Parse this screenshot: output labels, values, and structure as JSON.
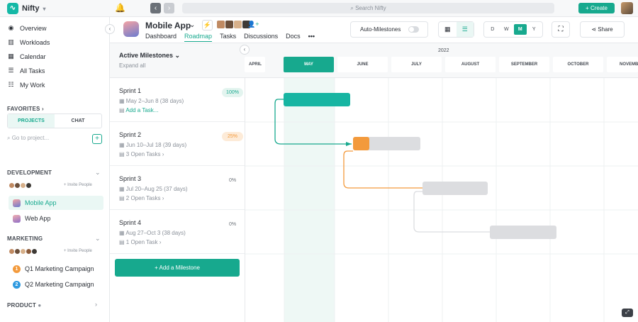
{
  "topbar": {
    "app_name": "Nifty",
    "search_placeholder": "Search Nifty",
    "create_label": "Create"
  },
  "sidebar": {
    "nav": [
      {
        "label": "Overview",
        "icon": "compass-icon"
      },
      {
        "label": "Workloads",
        "icon": "bar-chart-icon"
      },
      {
        "label": "Calendar",
        "icon": "calendar-icon"
      },
      {
        "label": "All Tasks",
        "icon": "list-icon"
      },
      {
        "label": "My Work",
        "icon": "checklist-icon"
      }
    ],
    "favorites_label": "FAVORITES",
    "tab_projects": "PROJECTS",
    "tab_chat": "CHAT",
    "goto_placeholder": "Go to project...",
    "development": {
      "label": "DEVELOPMENT",
      "invite": "+ Invite People",
      "projects": [
        "Mobile App",
        "Web App"
      ]
    },
    "marketing": {
      "label": "MARKETING",
      "invite": "+ Invite People",
      "projects": [
        "Q1 Marketing Campaign",
        "Q2 Marketing Campaign"
      ]
    },
    "product_label": "PRODUCT"
  },
  "header": {
    "project_title": "Mobile App",
    "tabs": [
      "Dashboard",
      "Roadmap",
      "Tasks",
      "Discussions",
      "Docs",
      "•••"
    ],
    "active_tab": "Roadmap",
    "auto_milestones": "Auto-Milestones",
    "auto_milestones_on": false,
    "scale": [
      "D",
      "W",
      "M",
      "Y"
    ],
    "active_scale": "M",
    "share_label": "Share"
  },
  "milestones": {
    "title": "Active Milestones",
    "expand_all": "Expand all",
    "sprints": [
      {
        "name": "Sprint 1",
        "dates": "May 2–Jun 8 (38 days)",
        "tasks": "Add a Task...",
        "progress": "100%"
      },
      {
        "name": "Sprint 2",
        "dates": "Jun 10–Jul 18 (39 days)",
        "tasks": "3 Open Tasks",
        "progress": "25%"
      },
      {
        "name": "Sprint 3",
        "dates": "Jul 20–Aug 25 (37 days)",
        "tasks": "2 Open Tasks",
        "progress": "0%"
      },
      {
        "name": "Sprint 4",
        "dates": "Aug 27–Oct 3 (38 days)",
        "tasks": "1 Open Task",
        "progress": "0%"
      }
    ],
    "add_label": "+ Add a Milestone"
  },
  "timeline": {
    "year": "2022",
    "months": [
      "APRIL",
      "MAY",
      "JUNE",
      "JULY",
      "AUGUST",
      "SEPTEMBER",
      "OCTOBER",
      "NOVEMBE"
    ],
    "current_month": "MAY"
  },
  "colors": {
    "accent": "#17a98e",
    "warning": "#f39a3c",
    "bar_done": "#17b5a2",
    "bar_todo": "#dcdde0"
  }
}
